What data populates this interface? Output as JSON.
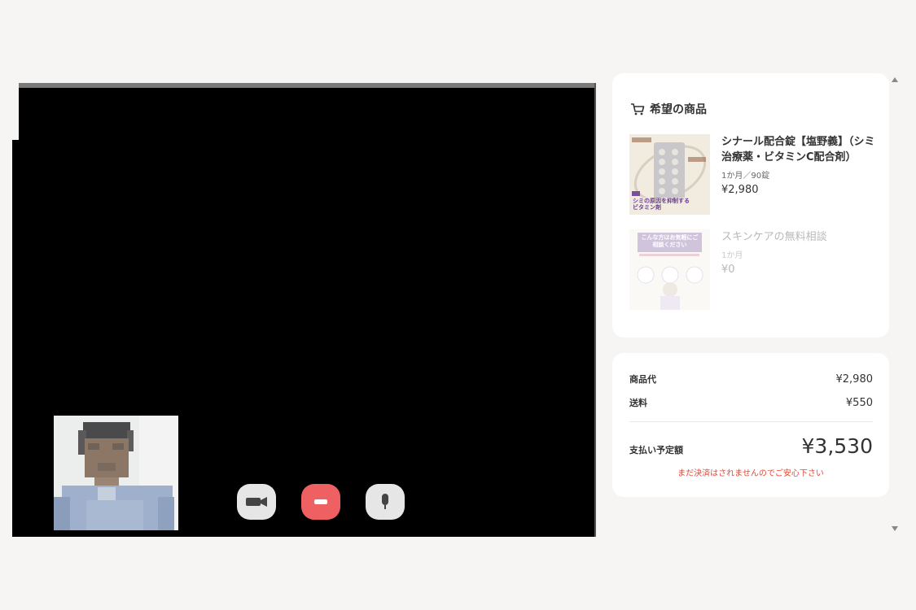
{
  "self_view": {
    "label": ""
  },
  "controls": [
    {
      "icon": "camera-icon",
      "color": "#e6e6e6"
    },
    {
      "icon": "end-call-icon",
      "color": "#ef6063"
    },
    {
      "icon": "microphone-icon",
      "color": "#e6e6e6"
    }
  ],
  "products_card": {
    "title": "希望の商品",
    "icon": "cart-icon",
    "items": [
      {
        "name": "シナール配合錠【塩野義】（シミ治療薬・ビタミンC配合剤）",
        "plan": "1か月／90錠",
        "price": "¥2,980",
        "thumb_caption": "シミの原因を抑制するビタミン剤"
      },
      {
        "name": "スキンケアの無料相談",
        "plan": "1か月",
        "price": "¥0",
        "thumb_caption": "こんな方はお気軽にご相談ください"
      }
    ]
  },
  "summary": {
    "product_label": "商品代",
    "product_value": "¥2,980",
    "shipping_label": "送料",
    "shipping_value": "¥550",
    "total_label": "支払い予定額",
    "total_value": "¥3,530",
    "notice": "まだ決済はされませんのでご安心下さい"
  },
  "colors": {
    "accent_red": "#ef6063",
    "notice_red": "#e0493a",
    "background": "#f6f5f3"
  }
}
